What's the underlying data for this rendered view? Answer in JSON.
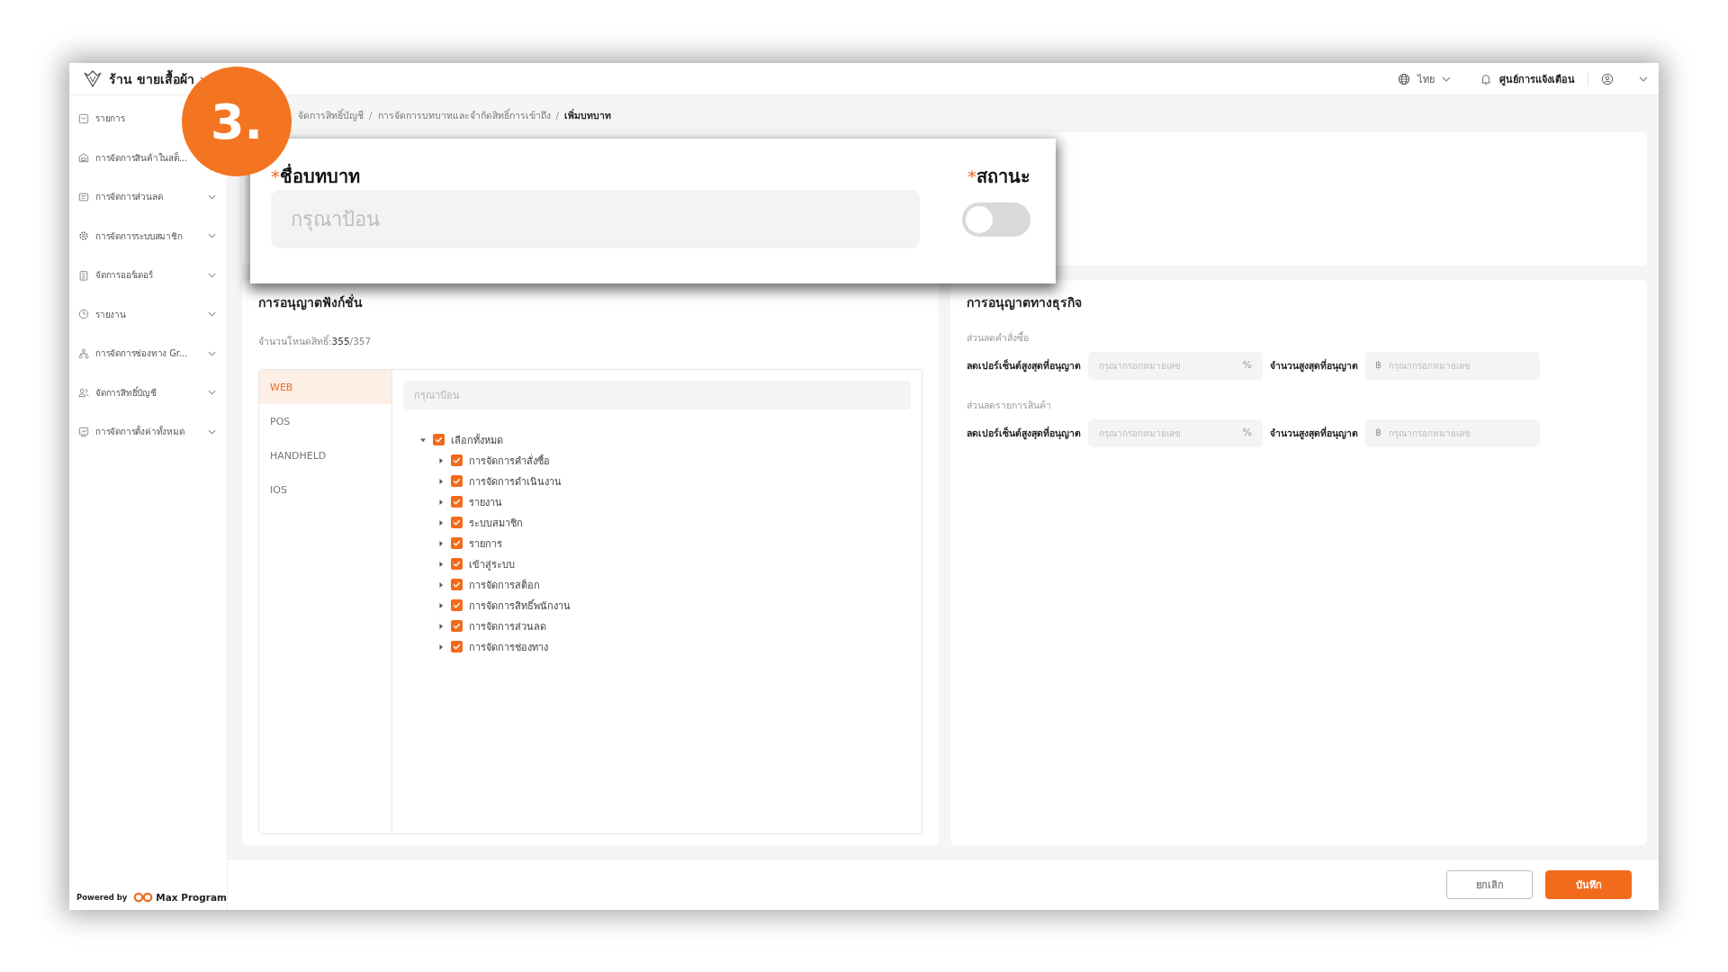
{
  "app": {
    "shop_name": "ร้าน ขายเสื้อผ้า",
    "language": "ไทย",
    "notifications": "ศูนย์การแจ้งเตือน"
  },
  "sidebar": {
    "items": [
      {
        "label": "รายการ",
        "expandable": false
      },
      {
        "label": "การจัดการสินค้าในสต็...",
        "expandable": false
      },
      {
        "label": "การจัดการส่วนลด",
        "expandable": true
      },
      {
        "label": "การจัดการระบบสมาชิก",
        "expandable": true
      },
      {
        "label": "จัดการออร์เดอร์",
        "expandable": true
      },
      {
        "label": "รายงาน",
        "expandable": true
      },
      {
        "label": "การจัดการช่องทาง Gr...",
        "expandable": true
      },
      {
        "label": "จัดการสิทธิ์บัญชี",
        "expandable": true
      },
      {
        "label": "การจัดการตั้งค่าทั้งหมด",
        "expandable": true
      }
    ],
    "footer": {
      "powered_by": "Powered by",
      "brand": "Max Program"
    }
  },
  "breadcrumb": [
    {
      "label": "จัดการสิทธิ์บัญชี",
      "current": false,
      "separator": "/"
    },
    {
      "label": "การจัดการบทบาทและจำกัดสิทธิ์การเข้าถึง",
      "current": false,
      "separator": "/"
    },
    {
      "label": "เพิ่มบทบาท",
      "current": true
    }
  ],
  "badge": "3.",
  "popup": {
    "role_name": {
      "mark": "*",
      "label": "ชื่อบทบาท",
      "placeholder": "กรุณาป้อน"
    },
    "status": {
      "mark": "*",
      "label": "สถานะ",
      "on": false
    }
  },
  "function_permissions": {
    "title": "การอนุญาตฟังก์ชั่น",
    "count_label": "จำนวนโหนดสิทธิ์:",
    "count_selected": "355",
    "count_total": "/357",
    "tabs": [
      {
        "label": "WEB",
        "selected": true
      },
      {
        "label": "POS",
        "selected": false
      },
      {
        "label": "HANDHELD",
        "selected": false
      },
      {
        "label": "IOS",
        "selected": false
      }
    ],
    "search": {
      "placeholder": "กรุณาป้อน"
    },
    "tree": [
      {
        "label": "เลือกทั้งหมด",
        "checked": true,
        "expanded": true,
        "children": [
          {
            "label": "การจัดการคำสั่งซื้อ",
            "checked": true,
            "expanded": false
          },
          {
            "label": "การจัดการดำเนินงาน",
            "checked": true,
            "expanded": false
          },
          {
            "label": "รายงาน",
            "checked": true,
            "expanded": false
          },
          {
            "label": "ระบบสมาชิก",
            "checked": true,
            "expanded": false
          },
          {
            "label": "รายการ",
            "checked": true,
            "expanded": false
          },
          {
            "label": "เข้าสู่ระบบ",
            "checked": true,
            "expanded": false
          },
          {
            "label": "การจัดการสต็อก",
            "checked": true,
            "expanded": false
          },
          {
            "label": "การจัดการสิทธิ์พนักงาน",
            "checked": true,
            "expanded": false
          },
          {
            "label": "การจัดการส่วนลด",
            "checked": true,
            "expanded": false
          },
          {
            "label": "การจัดการช่องทาง",
            "checked": true,
            "expanded": false
          }
        ]
      }
    ]
  },
  "business_permissions": {
    "title": "การอนุญาตทางธุรกิจ",
    "groups": [
      {
        "title": "ส่วนลดคำสั่งซื้อ",
        "percent_label": "ลดเปอร์เซ็นต์สูงสุดที่อนุญาต",
        "percent_placeholder": "กรุณากรอกหมายเลข",
        "percent_unit": "%",
        "amount_label": "จำนวนสูงสุดที่อนุญาต",
        "amount_prefix": "฿",
        "amount_placeholder": "กรุณากรอกหมายเลข"
      },
      {
        "title": "ส่วนลดรายการสินค้า",
        "percent_label": "ลดเปอร์เซ็นต์สูงสุดที่อนุญาต",
        "percent_placeholder": "กรุณากรอกหมายเลข",
        "percent_unit": "%",
        "amount_label": "จำนวนสูงสุดที่อนุญาต",
        "amount_prefix": "฿",
        "amount_placeholder": "กรุณากรอกหมายเลข"
      }
    ]
  },
  "footer": {
    "cancel": "ยกเลิก",
    "save": "บันทึก"
  }
}
